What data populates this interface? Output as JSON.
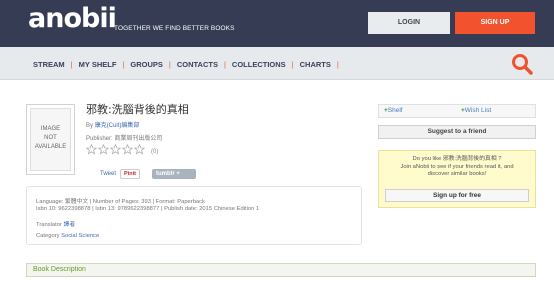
{
  "header": {
    "logo": "anobii",
    "tagline": "TOGETHER WE FIND BETTER BOOKS",
    "login_label": "LOGIN",
    "signup_label": "SIGN UP"
  },
  "nav": {
    "items": [
      "STREAM",
      "MY SHELF",
      "GROUPS",
      "CONTACTS",
      "COLLECTIONS",
      "CHARTS"
    ],
    "separator": "|"
  },
  "book": {
    "cover_text": [
      "IMAGE",
      "NOT",
      "AVAILABLE"
    ],
    "title": "邪教:洗腦背後的真相",
    "author_prefix": "By",
    "author": "康克(Cult)編集部",
    "publisher": "Publisher: 商業周刊出版公司",
    "rating_stars": 0,
    "rating_count": "(0)",
    "tweet_label": "Tweet",
    "pinit_label": "Pinit",
    "tumblr_label": "tumblr"
  },
  "details": {
    "line1": "Language: 繁體中文 | Number of Pages: 393 | Format: Paperback",
    "line2": "Isbn 10: 9622398878 | Isbn 13: 9789622398877 | Publish date: 2015 Chinese Edition 1",
    "translator_label": "Translator",
    "translator": "譯者",
    "category_label": "Category",
    "category": "Social Science"
  },
  "description_label": "Book Description",
  "sidebar": {
    "shelf_label": "Shelf",
    "wishlist_label": "Wish List",
    "suggest_label": "Suggest to a friend",
    "prompt_line1": "Do you like 邪教:洗腦背後的真相 ?",
    "prompt_line2": "Join aNobii to see if your friends read it, and",
    "prompt_line3": "discover similar books!",
    "signup_free_label": "Sign up for free"
  },
  "colors": {
    "topbar": "#363c53",
    "signup": "#f2522e",
    "nav_separator": "#e05a3a",
    "link": "#3b6bb5"
  }
}
